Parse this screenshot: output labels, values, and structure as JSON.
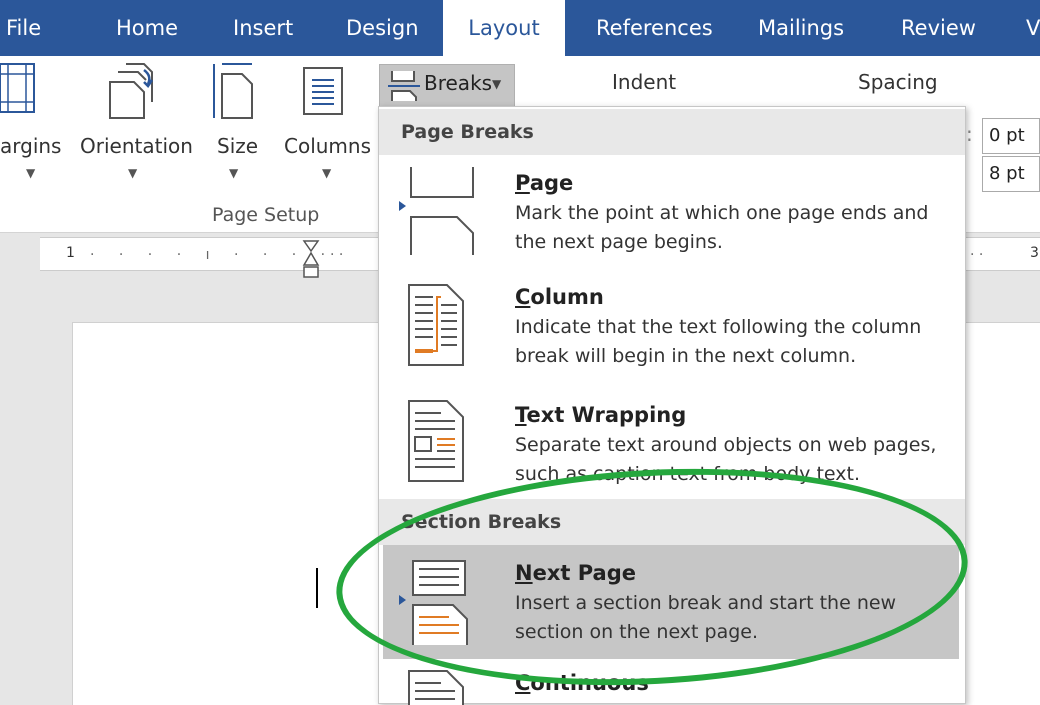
{
  "tabs": [
    {
      "label": "File"
    },
    {
      "label": "Home"
    },
    {
      "label": "Insert"
    },
    {
      "label": "Design"
    },
    {
      "label": "Layout",
      "active": true
    },
    {
      "label": "References"
    },
    {
      "label": "Mailings"
    },
    {
      "label": "Review"
    },
    {
      "label": "V"
    }
  ],
  "ribbon": {
    "margins_label": "argins",
    "orientation_label": "Orientation",
    "size_label": "Size",
    "columns_label": "Columns",
    "breaks_label": "Breaks",
    "indent_label": "Indent",
    "spacing_label": "Spacing",
    "group_label": "Page Setup",
    "spacing_before": "0 pt",
    "spacing_after": "8 pt",
    "spacing_colon": ":"
  },
  "ruler": {
    "left_number": "1",
    "right_number": "3"
  },
  "menu": {
    "page_breaks_header": "Page Breaks",
    "section_breaks_header": "Section Breaks",
    "items": [
      {
        "title_first": "P",
        "title_rest": "age",
        "desc": "Mark the point at which one page ends and the next page begins."
      },
      {
        "title_first": "C",
        "title_rest": "olumn",
        "desc": "Indicate that the text following the column break will begin in the next column."
      },
      {
        "title_first": "T",
        "title_rest": "ext Wrapping",
        "desc": "Separate text around objects on web pages, such as caption text from body text."
      },
      {
        "title_first": "N",
        "title_rest": "ext Page",
        "desc": "Insert a section break and start the new section on the next page."
      },
      {
        "title_first": "C",
        "title_rest": "ontinuous",
        "desc": ""
      }
    ]
  },
  "colors": {
    "ribbon_blue": "#2b579a",
    "annotation_green": "#25a73d",
    "icon_orange": "#e07b24",
    "highlight_gray": "#c6c6c6"
  }
}
